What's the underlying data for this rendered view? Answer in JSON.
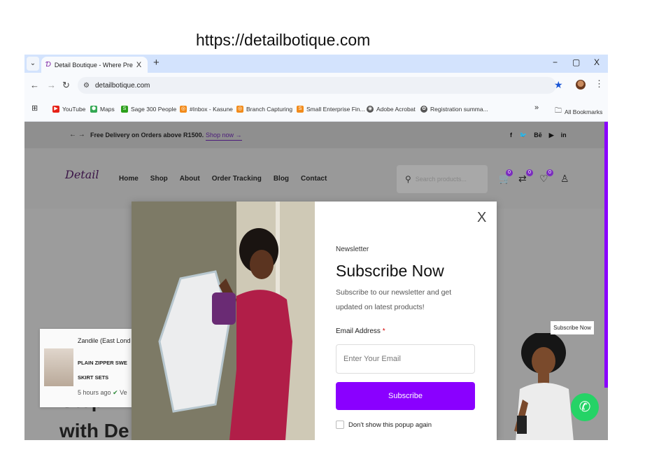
{
  "caption": "https://detailbotique.com",
  "browser": {
    "tab_search_icon": "chevron-down",
    "tab_title": "Detail Boutique - Where Precisi",
    "tab_close": "X",
    "new_tab": "+",
    "window_controls": [
      "−",
      "▢",
      "X"
    ],
    "url": "detailbotique.com",
    "bookmarks": [
      {
        "label": "YouTube",
        "color": "#e62117"
      },
      {
        "label": "Maps",
        "color": "#34a853"
      },
      {
        "label": "Sage 300 People",
        "color": "#2ca01c"
      },
      {
        "label": "#Inbox - Kasune",
        "color": "#f28b1b"
      },
      {
        "label": "Branch Capturing",
        "color": "#f28b1b"
      },
      {
        "label": "Small Enterprise Fin...",
        "color": "#f28b1b"
      },
      {
        "label": "Adobe Acrobat",
        "color": "#555555"
      },
      {
        "label": "Registration summa...",
        "color": "#555555"
      }
    ],
    "bookmarks_more": "»",
    "all_bookmarks": "All Bookmarks"
  },
  "site": {
    "promo_message": "Free Delivery on Orders above R1500.",
    "promo_link": "Shop now",
    "social_icons": [
      "facebook-icon",
      "twitter-icon",
      "behance-icon",
      "youtube-icon",
      "linkedin-icon"
    ],
    "social_glyphs": [
      "f",
      "🐦",
      "Bē",
      "▶",
      "in"
    ],
    "logo": "Detail",
    "nav": [
      "Home",
      "Shop",
      "About",
      "Order Tracking",
      "Blog",
      "Contact"
    ],
    "search_placeholder": "Search products...",
    "cart_count": "0",
    "compare_count": "0",
    "wishlist_count": "0",
    "subscribe_tag": "Subscribe Now",
    "hero_line1": "Step in",
    "hero_line2": "with De",
    "accent": "#8a00ff"
  },
  "notification": {
    "name": "Zandile (East Lond",
    "product_line1": "PLAIN ZIPPER SWE",
    "product_line2": "SKIRT SETS",
    "time": "5 hours ago",
    "verified": "Ve"
  },
  "modal": {
    "close": "X",
    "label": "Newsletter",
    "title": "Subscribe Now",
    "description": "Subscribe to our newsletter and get updated on latest products!",
    "email_label": "Email Address",
    "required_mark": "*",
    "email_placeholder": "Enter Your Email",
    "email_value": "",
    "button": "Subscribe",
    "dont_show": "Don't show this popup again"
  }
}
